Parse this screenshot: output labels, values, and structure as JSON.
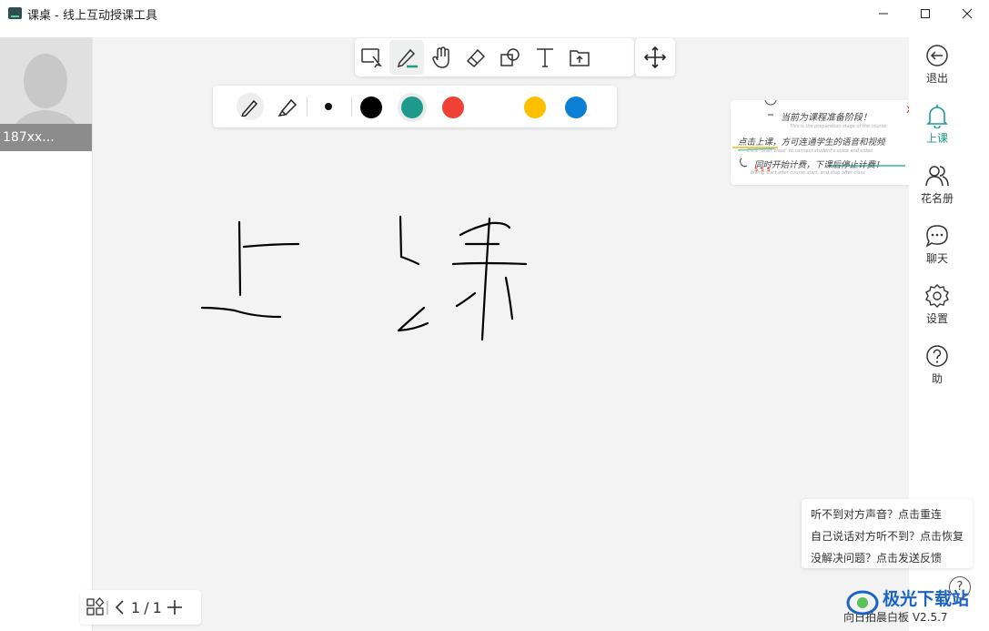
{
  "window": {
    "title": "课桌 - 线上互动授课工具"
  },
  "participant": {
    "name": "187xx..."
  },
  "toolbar": {
    "tools": [
      "select-icon",
      "pen-icon",
      "hand-icon",
      "eraser-icon",
      "shape-icon",
      "text-icon",
      "upload-icon"
    ],
    "active_tool": "pen-icon"
  },
  "pen_options": {
    "pens": [
      "pencil-icon",
      "highlighter-icon"
    ],
    "colors": [
      "#000000",
      "#1f9a8a",
      "#ef4136",
      "#fdbf00",
      "#0a7fd4"
    ],
    "selected_color": "#1f9a8a"
  },
  "sidebar": {
    "exit": "退出",
    "start_class": "上课",
    "roster": "花名册",
    "chat": "聊天",
    "settings": "设置",
    "help": "助"
  },
  "tip_card": {
    "close": "x",
    "line1": "当前为课程准备阶段！",
    "line1_sub": "This is the preparation stage of the course",
    "line2": "点击上课，方可连通学生的语音和视频",
    "line2_sub": "Click \"Start class\" to connect student's voice and video",
    "line3": "同时开始计费，下课后停止计费！",
    "line3_sub": "billing start after course start, and stop after class"
  },
  "help_popup": {
    "line1": "听不到对方声音？点击重连",
    "line2": "自己说话对方听不到？点击恢复",
    "line3": "没解决问题？点击发送反馈",
    "button": "?"
  },
  "pagination": {
    "current": "1",
    "separator": "/",
    "total": "1"
  },
  "footer": {
    "version": "向日拍晨白板 V2.5.7",
    "watermark": "极光下载站"
  },
  "colors": {
    "accent": "#1f9a8a",
    "canvas_bg": "#f3f3f3"
  }
}
